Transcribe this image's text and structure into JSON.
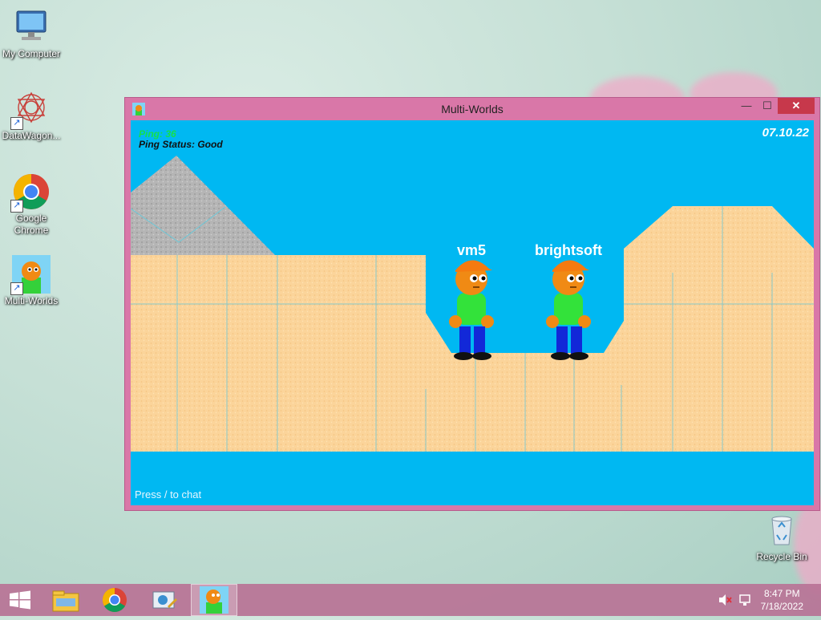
{
  "desktop": {
    "icons": [
      {
        "label": "My Computer"
      },
      {
        "label": "DataWagon..."
      },
      {
        "label": "Google Chrome"
      },
      {
        "label": "Multi-Worlds"
      },
      {
        "label": "Recycle Bin"
      }
    ]
  },
  "window": {
    "title": "Multi-Worlds",
    "buttons": {
      "minimize": "—",
      "maximize": "☐",
      "close": "✕"
    }
  },
  "game": {
    "ping_label": "Ping: 36",
    "ping_status": "Ping Status: Good",
    "date": "07.10.22",
    "players": [
      {
        "name": "vm5"
      },
      {
        "name": "brightsoft"
      }
    ],
    "chat_hint": "Press / to chat",
    "colors": {
      "sky": "#00b8f2",
      "sand": "#fbd49a",
      "rock": "#b5b5b5",
      "ping": "#14e04a"
    }
  },
  "taskbar": {
    "time": "8:47 PM",
    "date": "7/18/2022",
    "items": [
      "start-icon",
      "file-explorer-icon",
      "chrome-icon",
      "system-tools-icon",
      "multi-worlds-icon"
    ]
  }
}
